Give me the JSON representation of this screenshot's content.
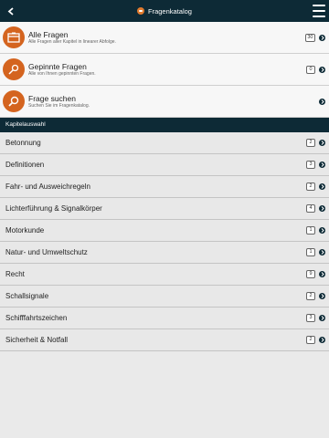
{
  "header": {
    "title": "Fragenkatalog",
    "back_icon": "chevron-left-icon",
    "menu_icon": "hamburger-menu-icon"
  },
  "top_items": [
    {
      "title": "Alle Fragen",
      "subtitle": "Alle Fragen aller Kapitel in linearer Abfolge.",
      "badge": "30",
      "icon": "box-icon"
    },
    {
      "title": "Gepinnte Fragen",
      "subtitle": "Alle von Ihnen gepinnten Fragen.",
      "badge": "0",
      "icon": "pin-icon"
    },
    {
      "title": "Frage suchen",
      "subtitle": "Suchen Sie im Fragenkatalog.",
      "badge": "",
      "icon": "search-icon"
    }
  ],
  "section": {
    "label": "Kapitelauswahl"
  },
  "chapters": [
    {
      "label": "Betonnung",
      "badge": "2"
    },
    {
      "label": "Definitionen",
      "badge": "3"
    },
    {
      "label": "Fahr- und Ausweichregeln",
      "badge": "2"
    },
    {
      "label": "Lichterführung & Signalkörper",
      "badge": "4"
    },
    {
      "label": "Motorkunde",
      "badge": "1"
    },
    {
      "label": "Natur- und Umweltschutz",
      "badge": "1"
    },
    {
      "label": "Recht",
      "badge": "9"
    },
    {
      "label": "Schallsignale",
      "badge": "2"
    },
    {
      "label": "Schifffahrtszeichen",
      "badge": "3"
    },
    {
      "label": "Sicherheit & Notfall",
      "badge": "2"
    }
  ],
  "colors": {
    "navbar": "#0d2a36",
    "accent": "#d4641f",
    "background": "#eaeaea"
  }
}
